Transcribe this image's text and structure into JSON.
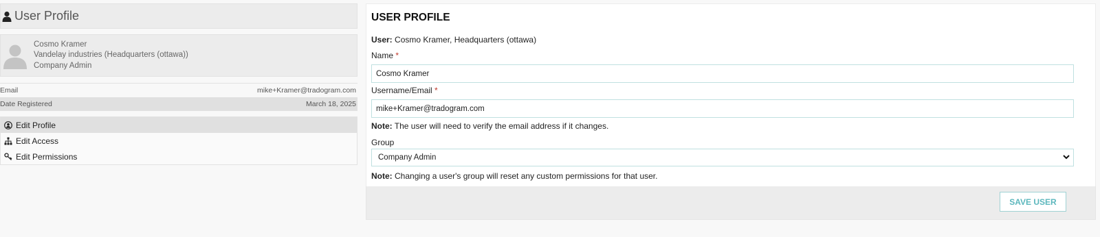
{
  "sidebar": {
    "title": "User Profile",
    "profile": {
      "name": "Cosmo Kramer",
      "company": "Vandelay industries (Headquarters (ottawa))",
      "role": "Company Admin"
    },
    "details": [
      {
        "label": "Email",
        "value": "mike+Kramer@tradogram.com"
      },
      {
        "label": "Date Registered",
        "value": "March 18, 2025"
      }
    ],
    "menu": [
      {
        "label": "Edit Profile",
        "icon": "user-circle-icon",
        "active": true
      },
      {
        "label": "Edit Access",
        "icon": "sitemap-icon",
        "active": false
      },
      {
        "label": "Edit Permissions",
        "icon": "key-icon",
        "active": false
      }
    ]
  },
  "form": {
    "title": "USER PROFILE",
    "user_label": "User:",
    "user_value": " Cosmo Kramer, Headquarters (ottawa)",
    "name_label": "Name",
    "name_value": "Cosmo Kramer",
    "email_label": "Username/Email",
    "email_value": "mike+Kramer@tradogram.com",
    "required_marker": "*",
    "note_label": "Note:",
    "email_note": " The user will need to verify the email address if it changes.",
    "group_label": "Group",
    "group_value": "Company Admin",
    "group_note": " Changing a user's group will reset any custom permissions for that user.",
    "save_label": "SAVE USER"
  },
  "colors": {
    "accent": "#5cb7bd",
    "required": "#c0392b",
    "panel_bg": "#ececec"
  }
}
